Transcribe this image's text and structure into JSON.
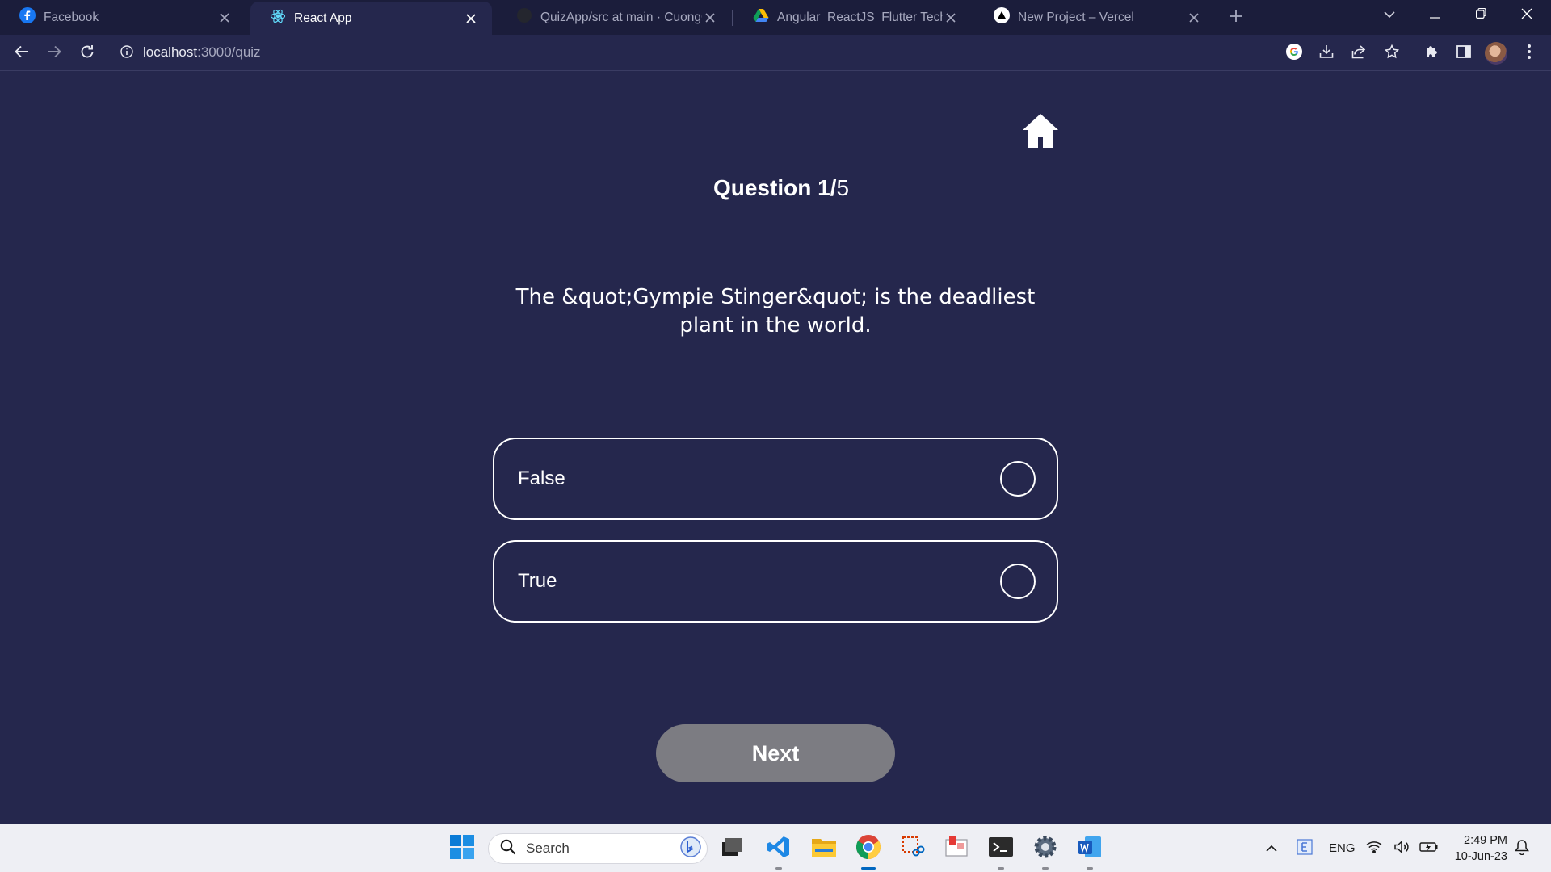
{
  "browser": {
    "tabs": [
      {
        "title": "Facebook",
        "icon": "facebook-icon",
        "active": false
      },
      {
        "title": "React App",
        "icon": "react-icon",
        "active": true
      },
      {
        "title": "QuizApp/src at main · CuongGo",
        "icon": "github-icon",
        "active": false
      },
      {
        "title": "Angular_ReactJS_Flutter Technica",
        "icon": "google-drive-icon",
        "active": false
      },
      {
        "title": "New Project – Vercel",
        "icon": "vercel-icon",
        "active": false
      }
    ],
    "address": {
      "host": "localhost",
      "path": ":3000/quiz"
    }
  },
  "quiz": {
    "title_prefix": "Question ",
    "current": "1",
    "separator": "/",
    "total": "5",
    "question": "The &quot;Gympie Stinger&quot; is the deadliest plant in the world.",
    "options": [
      "False",
      "True"
    ],
    "next_label": "Next"
  },
  "taskbar": {
    "search_placeholder": "Search",
    "language": "ENG",
    "time": "2:49 PM",
    "date": "10-Jun-23"
  },
  "colors": {
    "page_background": "#25274d",
    "tabstrip_background": "#1b1d3b",
    "next_button": "#7c7c82",
    "option_border": "#ffffff"
  }
}
